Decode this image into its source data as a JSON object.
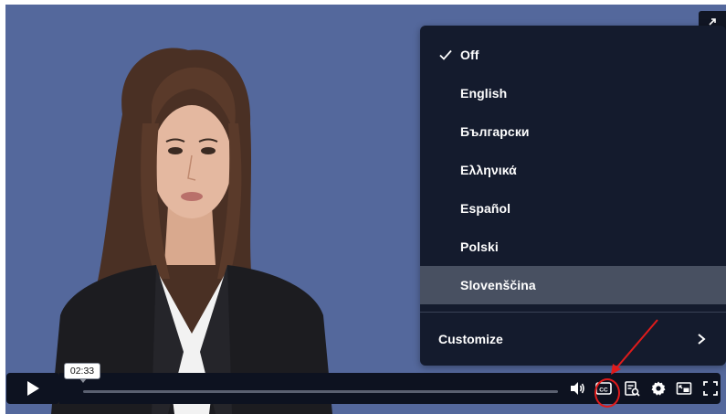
{
  "player": {
    "time_tooltip": "02:33",
    "colors": {
      "background": "#54689c",
      "menu_bg": "#141b2d",
      "menu_highlight": "#485061",
      "annotation": "#e01b1b"
    }
  },
  "captions_menu": {
    "items": [
      {
        "label": "Off",
        "checked": true
      },
      {
        "label": "English",
        "checked": false
      },
      {
        "label": "Български",
        "checked": false
      },
      {
        "label": "Ελληνικά",
        "checked": false
      },
      {
        "label": "Español",
        "checked": false
      },
      {
        "label": "Polski",
        "checked": false
      },
      {
        "label": "Slovenščina",
        "checked": false,
        "highlighted": true
      }
    ],
    "customize_label": "Customize"
  },
  "controls": {
    "icons": [
      "play-icon",
      "volume-icon",
      "closed-captions-icon",
      "transcript-icon",
      "settings-gear-icon",
      "picture-in-picture-icon",
      "fullscreen-icon"
    ]
  }
}
